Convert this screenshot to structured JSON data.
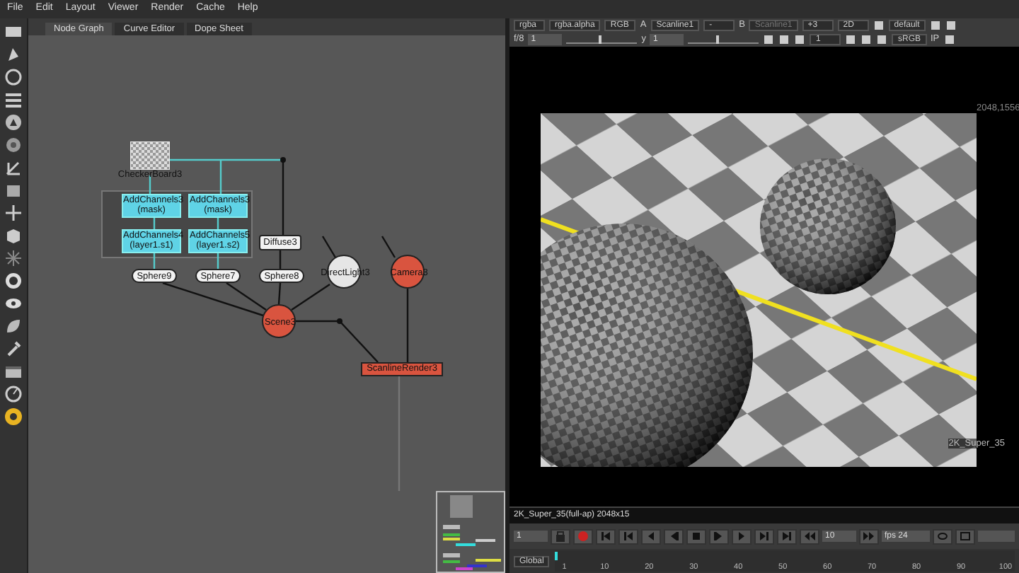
{
  "menu": [
    "File",
    "Edit",
    "Layout",
    "Viewer",
    "Render",
    "Cache",
    "Help"
  ],
  "node_graph": {
    "tabs": [
      {
        "label": "Node Graph",
        "selected": true
      },
      {
        "label": "Curve Editor",
        "selected": false
      },
      {
        "label": "Dope Sheet",
        "selected": false
      }
    ],
    "nodes": [
      {
        "kind": "checker",
        "label": "CheckerBoard3"
      },
      {
        "kind": "channels",
        "label": "AddChannels3",
        "sublabel": "(mask)"
      },
      {
        "kind": "channels",
        "label": "AddChannels3",
        "sublabel": "(mask)"
      },
      {
        "kind": "channels",
        "label": "AddChannels4",
        "sublabel": "(layer1.s1)"
      },
      {
        "kind": "channels",
        "label": "AddChannels5",
        "sublabel": "(layer1.s2)"
      },
      {
        "kind": "shader",
        "label": "Diffuse3"
      },
      {
        "kind": "geo",
        "label": "Sphere9"
      },
      {
        "kind": "geo",
        "label": "Sphere7"
      },
      {
        "kind": "geo",
        "label": "Sphere8"
      },
      {
        "kind": "light",
        "label": "DirectLight3"
      },
      {
        "kind": "camera",
        "label": "Camera3"
      },
      {
        "kind": "scene",
        "label": "Scene3"
      },
      {
        "kind": "render",
        "label": "ScanlineRender3"
      }
    ]
  },
  "viewer": {
    "toolbar": [
      {
        "kind": "dropdown",
        "text": "rgba"
      },
      {
        "kind": "dropdown",
        "text": "rgba.alpha"
      },
      {
        "kind": "dropdown",
        "text": "RGB"
      },
      {
        "kind": "label",
        "text": "A"
      },
      {
        "kind": "dropdown",
        "text": "Scanline1"
      },
      {
        "kind": "dropdown",
        "text": "-"
      },
      {
        "kind": "label",
        "text": "B"
      },
      {
        "kind": "inactive",
        "text": "Scanline1"
      },
      {
        "kind": "dropdown",
        "text": "+3"
      },
      {
        "kind": "dropdown",
        "text": "2D"
      },
      {
        "kind": "icon"
      },
      {
        "kind": "dropdown",
        "text": "default"
      },
      {
        "kind": "icon"
      },
      {
        "kind": "icon"
      }
    ],
    "toolbar2": [
      {
        "kind": "label",
        "text": "f/8"
      },
      {
        "kind": "field",
        "text": "1"
      },
      {
        "kind": "slider",
        "level": 0.45
      },
      {
        "kind": "label",
        "text": "y"
      },
      {
        "kind": "field",
        "text": "1"
      },
      {
        "kind": "slider",
        "level": 0.4
      },
      {
        "kind": "icon"
      },
      {
        "kind": "icon"
      },
      {
        "kind": "icon"
      },
      {
        "kind": "dropdown",
        "text": "1"
      },
      {
        "kind": "icon"
      },
      {
        "kind": "icon"
      },
      {
        "kind": "icon"
      },
      {
        "kind": "dropdown",
        "text": "sRGB"
      },
      {
        "kind": "label",
        "text": "IP"
      },
      {
        "kind": "icon"
      }
    ],
    "image": {
      "size_label": "2048,1556",
      "format_label": "2K_Super_35"
    },
    "format_bar": "2K_Super_35(full-ap) 2048x15",
    "playback": {
      "frame": "1",
      "step": "10",
      "fps": "fps 24"
    },
    "timeline": {
      "scope": "Global",
      "level": 0,
      "ticks": [
        "1",
        "10",
        "20",
        "30",
        "40",
        "50",
        "60",
        "70",
        "80",
        "90",
        "100"
      ]
    }
  }
}
